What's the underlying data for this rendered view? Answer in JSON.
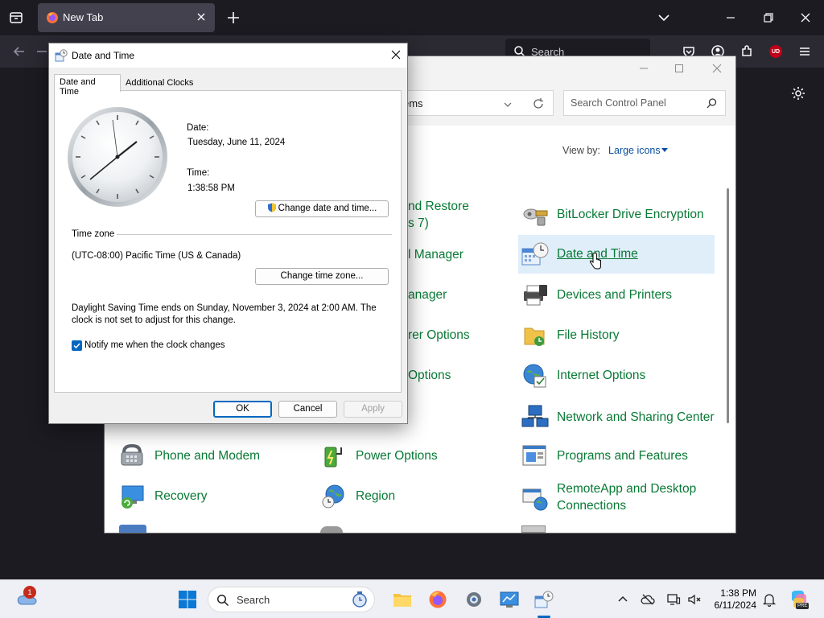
{
  "browser": {
    "tab_title": "New Tab",
    "search_placeholder": "Search",
    "ublock_badge": "UD"
  },
  "control_panel": {
    "address_text": "ems",
    "search_placeholder": "Search Control Panel",
    "view_by_label": "View by:",
    "view_by_value": "Large icons",
    "left_fragments": [
      "nd Restore",
      "s 7)",
      "l Manager",
      "anager",
      "rer Options",
      "Options"
    ],
    "right_items": [
      {
        "label": "BitLocker Drive Encryption",
        "icon": "bitlocker-icon"
      },
      {
        "label": "Date and Time",
        "icon": "date-time-icon"
      },
      {
        "label": "Devices and Printers",
        "icon": "printer-icon"
      },
      {
        "label": "File History",
        "icon": "file-history-icon"
      },
      {
        "label": "Internet Options",
        "icon": "internet-options-icon"
      },
      {
        "label": "Network and Sharing Center",
        "icon": "network-icon"
      },
      {
        "label": "Programs and Features",
        "icon": "programs-icon"
      },
      {
        "label": "RemoteApp and Desktop Connections",
        "icon": "remoteapp-icon"
      }
    ],
    "bottom_items": [
      {
        "label": "Phone and Modem",
        "icon": "phone-icon"
      },
      {
        "label": "Power Options",
        "icon": "power-icon"
      },
      {
        "label": "Recovery",
        "icon": "recovery-icon"
      },
      {
        "label": "Region",
        "icon": "region-icon"
      }
    ]
  },
  "dialog": {
    "title": "Date and Time",
    "tabs": [
      "Date and Time",
      "Additional Clocks"
    ],
    "date_label": "Date:",
    "date_value": "Tuesday, June 11, 2024",
    "time_label": "Time:",
    "time_value": "1:38:58 PM",
    "change_datetime_button": "Change date and time...",
    "timezone_label": "Time zone",
    "timezone_value": "(UTC-08:00) Pacific Time (US & Canada)",
    "change_timezone_button": "Change time zone...",
    "dst_notice": "Daylight Saving Time ends on Sunday, November 3, 2024 at 2:00 AM. The clock is not set to adjust for this change.",
    "notify_checkbox": "Notify me when the clock changes",
    "notify_checked": true,
    "ok_button": "OK",
    "cancel_button": "Cancel",
    "apply_button": "Apply"
  },
  "taskbar": {
    "search_placeholder": "Search",
    "notification_count": "1",
    "time": "1:38 PM",
    "date": "6/11/2024",
    "copilot_badge": "PRE"
  },
  "colors": {
    "link_green": "#087a35",
    "accent_blue": "#0067c0",
    "firefox_dark": "#1c1b22"
  }
}
